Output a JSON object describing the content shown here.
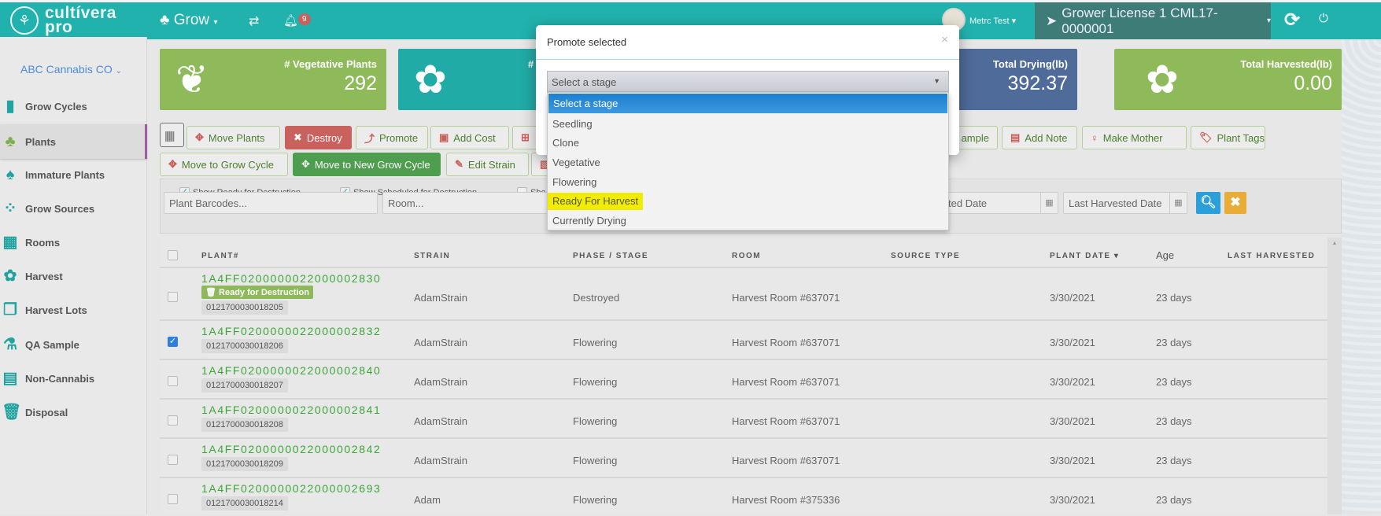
{
  "topbar": {
    "logo": "cultívera pro",
    "module": "Grow",
    "notifications": "9",
    "user": "Metrc Test",
    "license": "Grower License 1 CML17-0000001"
  },
  "sidebar": {
    "company": "ABC Cannabis CO",
    "items": [
      {
        "label": "Grow Cycles",
        "icon": "bar-chart-icon"
      },
      {
        "label": "Plants",
        "icon": "tree-icon",
        "active": true
      },
      {
        "label": "Immature Plants",
        "icon": "sapling-icon"
      },
      {
        "label": "Grow Sources",
        "icon": "seeds-icon"
      },
      {
        "label": "Rooms",
        "icon": "rooms-icon"
      },
      {
        "label": "Harvest",
        "icon": "flower-icon"
      },
      {
        "label": "Harvest Lots",
        "icon": "lots-icon"
      },
      {
        "label": "QA Sample",
        "icon": "flask-icon"
      },
      {
        "label": "Non-Cannabis",
        "icon": "box-icon"
      },
      {
        "label": "Disposal",
        "icon": "trash-icon"
      }
    ]
  },
  "cards": [
    {
      "label": "# Vegetative Plants",
      "value": "292",
      "color": "#8fba5a"
    },
    {
      "label": "#",
      "value": "",
      "color": "#21aba6"
    },
    {
      "label": "Total Drying(lb)",
      "value": "392.37",
      "color": "#4f6b99"
    },
    {
      "label": "Total Harvested(lb)",
      "value": "0.00",
      "color": "#8fba5a"
    }
  ],
  "toolbar": {
    "move_plants": "Move Plants",
    "destroy": "Destroy",
    "promote": "Promote",
    "add_cost": "Add Cost",
    "qa_sample": "ample",
    "add_note": "Add Note",
    "make_mother": "Make Mother",
    "plant_tags": "Plant Tags",
    "move_to_grow_cycle": "Move to Grow Cycle",
    "move_to_new_grow_cycle": "Move to New Grow Cycle",
    "edit_strain": "Edit Strain"
  },
  "filters": {
    "show_ready": "Show Ready for Destruction",
    "show_scheduled": "Show Scheduled for Destruction",
    "show_other": "Sho",
    "plant_barcodes": "Plant Barcodes...",
    "room": "Room...",
    "planted_date": "Planted Date",
    "last_harvested_date": "Last Harvested Date"
  },
  "table": {
    "columns": [
      "PLANT#",
      "STRAIN",
      "PHASE / STAGE",
      "ROOM",
      "SOURCE TYPE",
      "PLANT DATE",
      "Age",
      "LAST HARVESTED"
    ],
    "rows": [
      {
        "plant": "1A4FF0200000022000002830",
        "badge": "Ready for Destruction",
        "barcode": "0121700030018205",
        "strain": "AdamStrain",
        "stage": "Destroyed",
        "room": "Harvest Room #637071",
        "date": "3/30/2021",
        "age": "23 days",
        "checked": false
      },
      {
        "plant": "1A4FF0200000022000002832",
        "barcode": "0121700030018206",
        "strain": "AdamStrain",
        "stage": "Flowering",
        "room": "Harvest Room #637071",
        "date": "3/30/2021",
        "age": "23 days",
        "checked": true
      },
      {
        "plant": "1A4FF0200000022000002840",
        "barcode": "0121700030018207",
        "strain": "AdamStrain",
        "stage": "Flowering",
        "room": "Harvest Room #637071",
        "date": "3/30/2021",
        "age": "23 days",
        "checked": false
      },
      {
        "plant": "1A4FF0200000022000002841",
        "barcode": "0121700030018208",
        "strain": "AdamStrain",
        "stage": "Flowering",
        "room": "Harvest Room #637071",
        "date": "3/30/2021",
        "age": "23 days",
        "checked": false
      },
      {
        "plant": "1A4FF0200000022000002842",
        "barcode": "0121700030018209",
        "strain": "AdamStrain",
        "stage": "Flowering",
        "room": "Harvest Room #637071",
        "date": "3/30/2021",
        "age": "23 days",
        "checked": false
      },
      {
        "plant": "1A4FF0200000022000002693",
        "barcode": "0121700030018214",
        "strain": "Adam",
        "stage": "Flowering",
        "room": "Harvest Room #375336",
        "date": "3/30/2021",
        "age": "23 days",
        "checked": false
      }
    ]
  },
  "modal": {
    "title": "Promote selected",
    "select_value": "Select a stage",
    "options": [
      "Select a stage",
      "Seedling",
      "Clone",
      "Vegetative",
      "Flowering",
      "Ready For Harvest",
      "Currently Drying"
    ],
    "highlighted_option": "Ready For Harvest"
  }
}
